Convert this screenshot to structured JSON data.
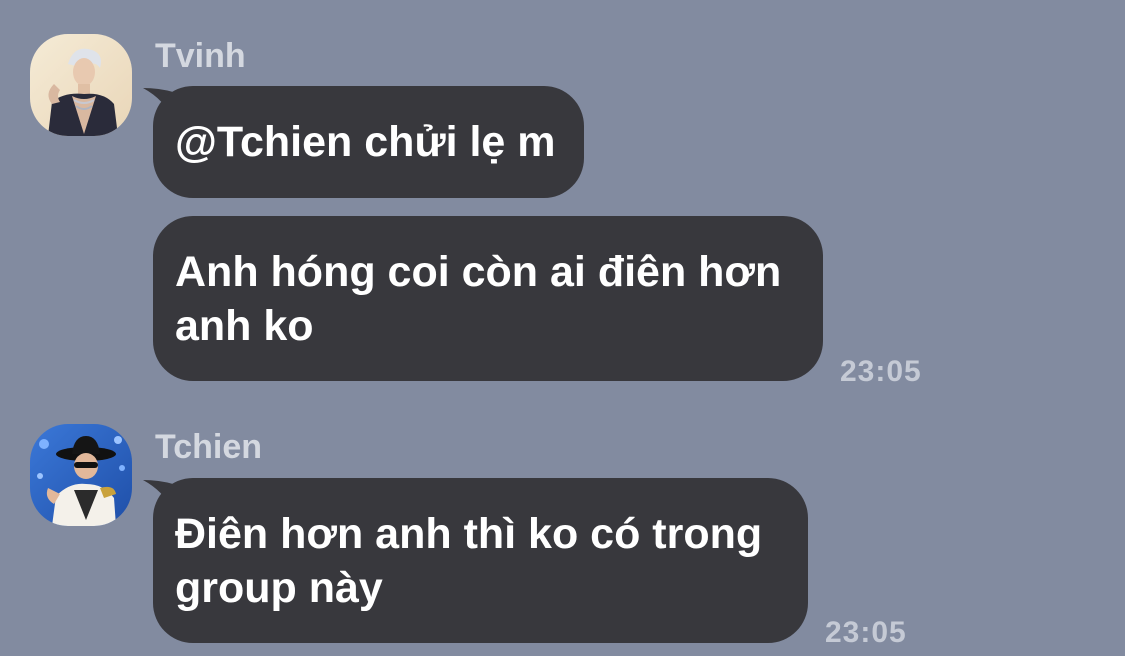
{
  "colors": {
    "background": "#828ba0",
    "bubble": "#38383d",
    "bubble_text": "#ffffff",
    "sender_name": "#d4d8e0",
    "timestamp": "#c5cad5"
  },
  "messages": [
    {
      "sender": "Tvinh",
      "avatar_icon": "avatar-photo-silver-hair",
      "bubbles": [
        {
          "text": "@Tchien chửi lẹ m"
        },
        {
          "text": "Anh hóng coi còn ai điên hơn\nanh ko",
          "time": "23:05"
        }
      ]
    },
    {
      "sender": "Tchien",
      "avatar_icon": "avatar-photo-black-hat",
      "bubbles": [
        {
          "text": "Điên hơn anh thì ko có trong\ngroup này",
          "time": "23:05"
        }
      ]
    }
  ]
}
